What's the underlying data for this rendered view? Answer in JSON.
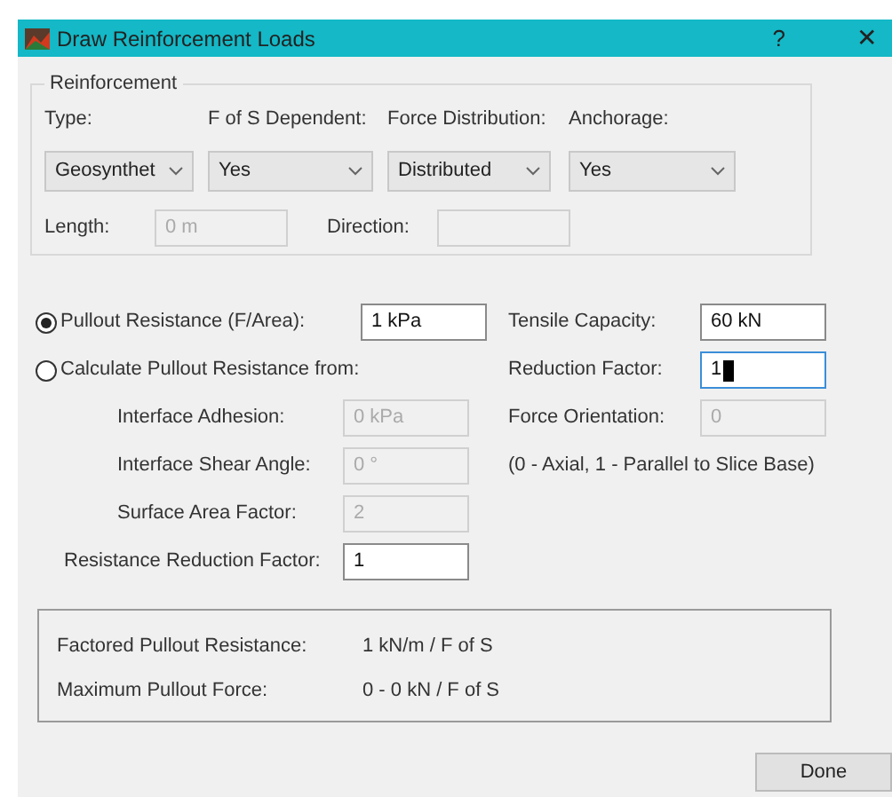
{
  "window": {
    "title": "Draw Reinforcement Loads",
    "help": "?",
    "close": "✕"
  },
  "reinforcement": {
    "title": "Reinforcement",
    "columns": [
      {
        "label": "Type:",
        "value": "Geosynthet"
      },
      {
        "label": "F of S Dependent:",
        "value": "Yes"
      },
      {
        "label": "Force Distribution:",
        "value": "Distributed"
      },
      {
        "label": "Anchorage:",
        "value": "Yes"
      }
    ],
    "length": {
      "label": "Length:",
      "value": "0 m",
      "disabled": true
    },
    "direction": {
      "label": "Direction:",
      "disabled": true
    }
  },
  "pullout_modes": [
    {
      "label": "Pullout Resistance (F/Area):",
      "selected": true,
      "value": "1 kPa"
    },
    {
      "label": "Calculate Pullout Resistance from:",
      "selected": false
    }
  ],
  "calc_fields": [
    {
      "label": "Interface Adhesion:",
      "value": "0 kPa",
      "disabled": true
    },
    {
      "label": "Interface Shear Angle:",
      "value": "0 °",
      "disabled": true
    },
    {
      "label": "Surface Area Factor:",
      "value": "2",
      "disabled": true
    }
  ],
  "resistance_reduction": {
    "label": "Resistance Reduction Factor:",
    "value": "1",
    "disabled": false
  },
  "right_fields": [
    {
      "label": "Tensile Capacity:",
      "value": "60 kN",
      "disabled": false,
      "focused": false
    },
    {
      "label": "Reduction Factor:",
      "value": "1",
      "disabled": false,
      "focused": true
    },
    {
      "label": "Force Orientation:",
      "value": "0",
      "disabled": true,
      "focused": false
    }
  ],
  "orientation_note": "(0 - Axial, 1 - Parallel to Slice Base)",
  "summary": [
    {
      "label": "Factored Pullout Resistance:",
      "value": "1 kN/m / F of S"
    },
    {
      "label": "Maximum Pullout Force:",
      "value": "0 - 0 kN / F of S"
    }
  ],
  "buttons": [
    "Done"
  ]
}
